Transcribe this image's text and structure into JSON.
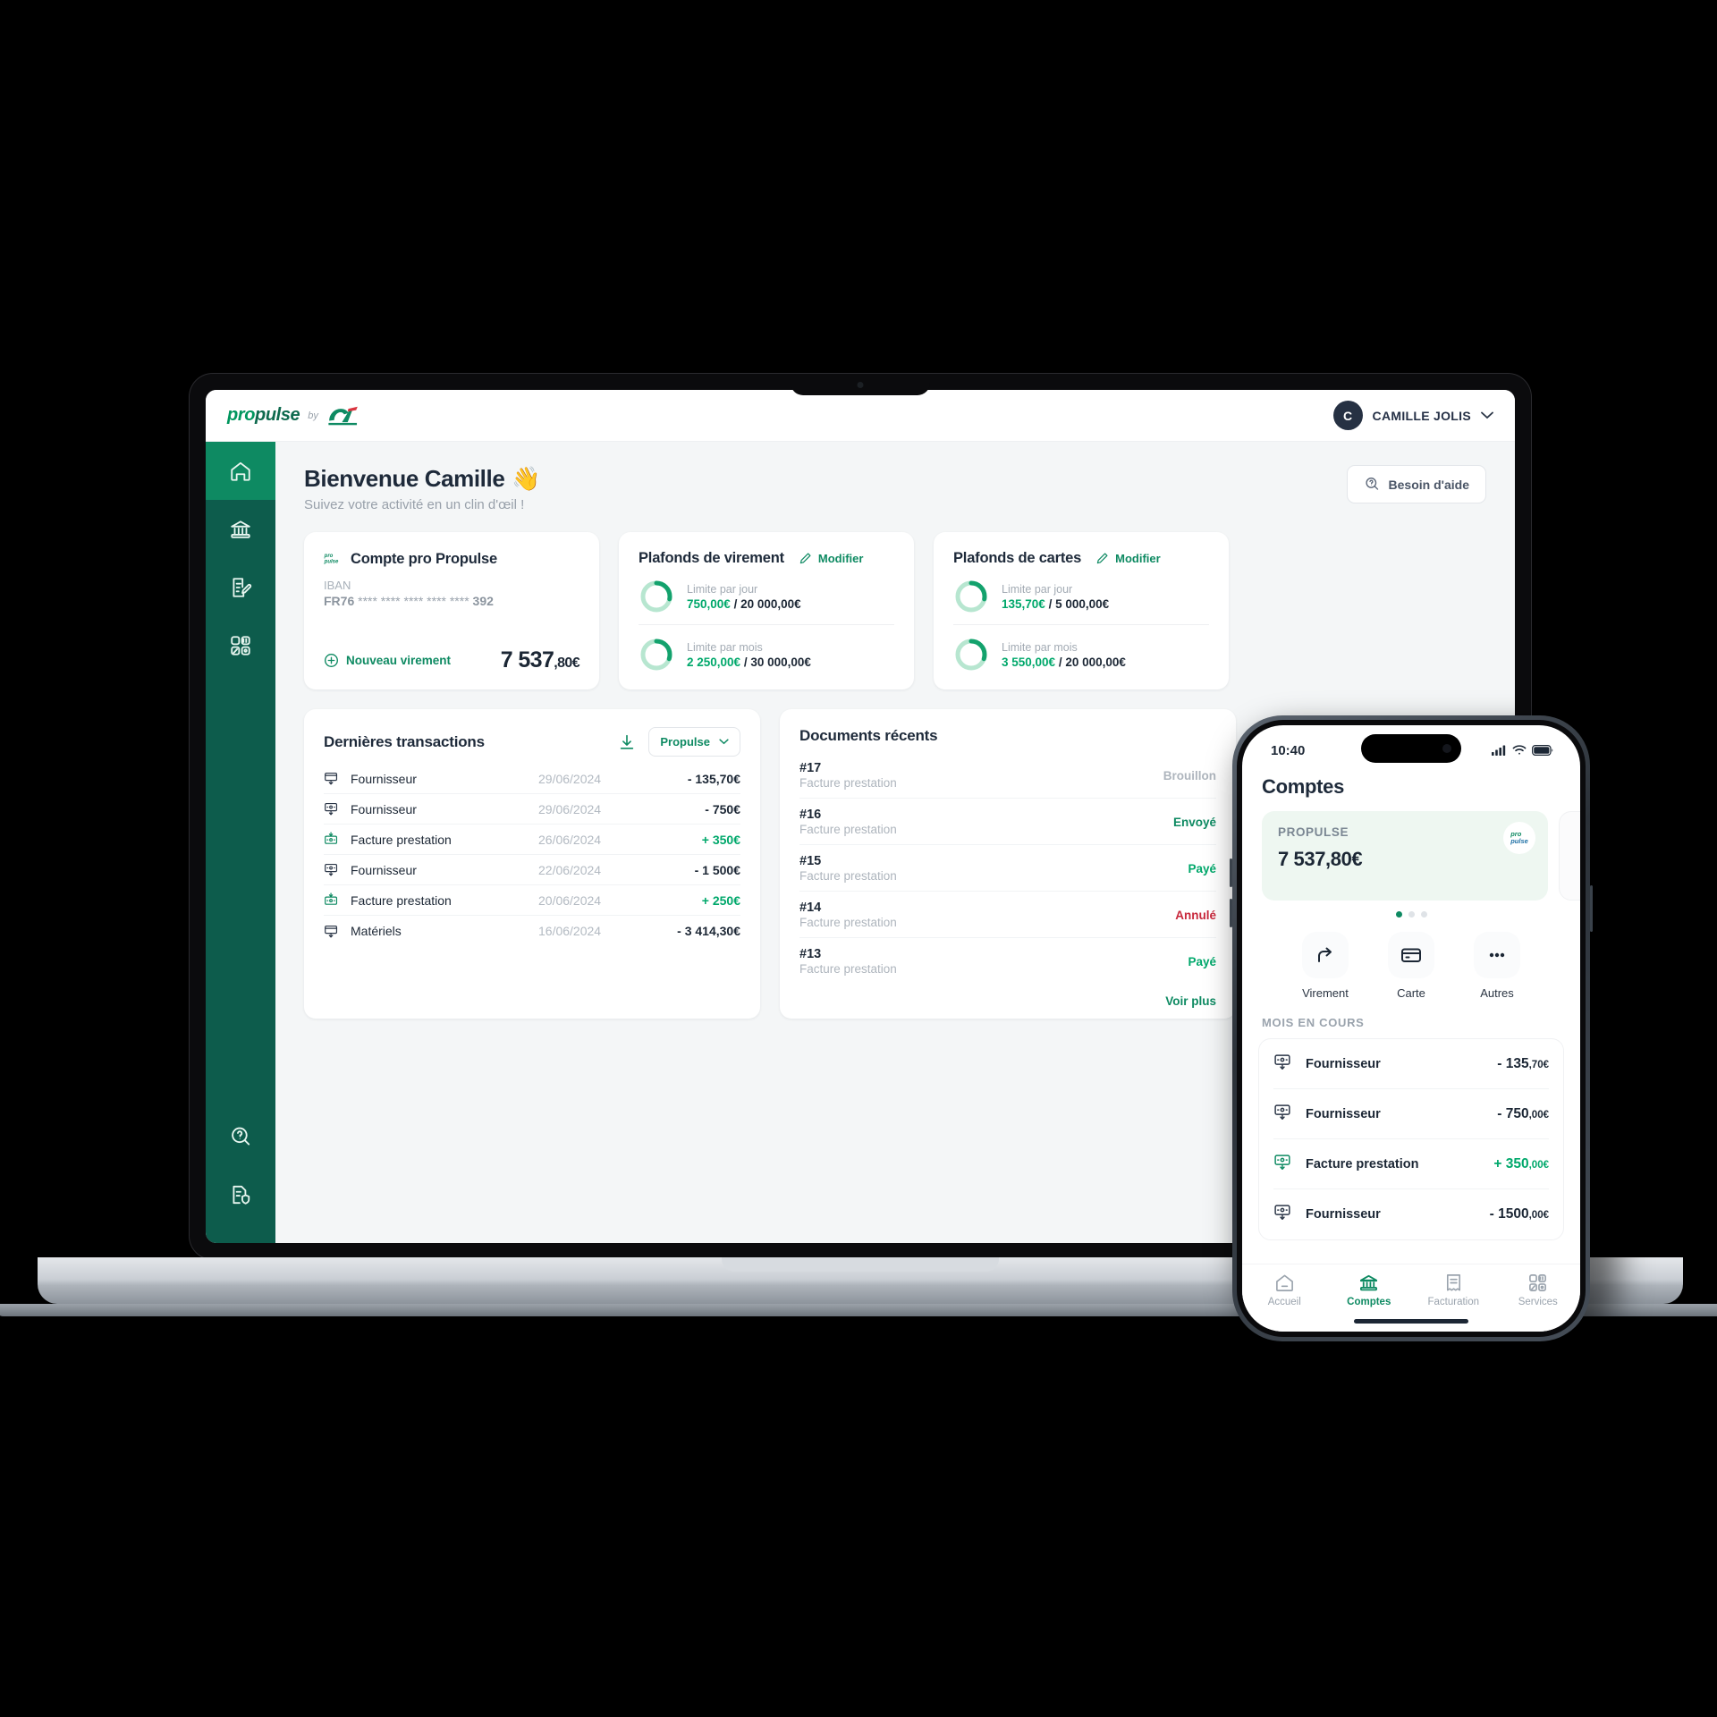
{
  "desktop": {
    "brand": {
      "name_pro": "pro",
      "name_pulse": "pulse",
      "by": "by",
      "ca": "CA"
    },
    "user": {
      "initial": "C",
      "name": "CAMILLE JOLIS"
    },
    "welcome": {
      "title": "Bienvenue Camille",
      "emoji": "👋",
      "subtitle": "Suivez votre activité en un clin d'œil !"
    },
    "help_button": "Besoin d'aide",
    "sidebar": [
      {
        "name": "home",
        "label": "Accueil",
        "active": true
      },
      {
        "name": "bank",
        "label": "Comptes",
        "active": false
      },
      {
        "name": "invoice-edit",
        "label": "Facturation",
        "active": false
      },
      {
        "name": "services-grid",
        "label": "Services",
        "active": false
      },
      {
        "name": "help-search",
        "label": "Aide",
        "active": false
      },
      {
        "name": "document-shield",
        "label": "Documents",
        "active": false
      }
    ],
    "account_card": {
      "title": "Compte pro Propulse",
      "iban_label": "IBAN",
      "iban_prefix": "FR76",
      "iban_mask": "**** **** **** **** ****",
      "iban_last": "392",
      "new_transfer": "Nouveau virement",
      "balance_main": "7 537",
      "balance_cents": ",80€"
    },
    "transfer_limits": {
      "title": "Plafonds de virement",
      "edit": "Modifier",
      "rows": [
        {
          "label": "Limite par jour",
          "used": "750,00€",
          "sep": " / ",
          "total": "20 000,00€",
          "pct": 28
        },
        {
          "label": "Limite par mois",
          "used": "2 250,00€",
          "sep": " / ",
          "total": "30 000,00€",
          "pct": 30
        }
      ]
    },
    "card_limits": {
      "title": "Plafonds de cartes",
      "edit": "Modifier",
      "rows": [
        {
          "label": "Limite par jour",
          "used": "135,70€",
          "sep": " / ",
          "total": "5 000,00€",
          "pct": 28
        },
        {
          "label": "Limite par mois",
          "used": "3 550,00€",
          "sep": " / ",
          "total": "20 000,00€",
          "pct": 30
        }
      ]
    },
    "transactions": {
      "title": "Dernières transactions",
      "filter": "Propulse",
      "rows": [
        {
          "icon": "card-down",
          "label": "Fournisseur",
          "date": "29/06/2024",
          "amount": "- 135,70€",
          "positive": false
        },
        {
          "icon": "transfer-down",
          "label": "Fournisseur",
          "date": "29/06/2024",
          "amount": "- 750€",
          "positive": false
        },
        {
          "icon": "transfer-in",
          "label": "Facture prestation",
          "date": "26/06/2024",
          "amount": "+ 350€",
          "positive": true
        },
        {
          "icon": "transfer-down",
          "label": "Fournisseur",
          "date": "22/06/2024",
          "amount": "- 1 500€",
          "positive": false
        },
        {
          "icon": "transfer-in",
          "label": "Facture prestation",
          "date": "20/06/2024",
          "amount": "+ 250€",
          "positive": true
        },
        {
          "icon": "card-down",
          "label": "Matériels",
          "date": "16/06/2024",
          "amount": "- 3 414,30€",
          "positive": false
        }
      ]
    },
    "documents": {
      "title": "Documents récents",
      "see_more": "Voir plus",
      "rows": [
        {
          "num": "#17",
          "type": "Facture prestation",
          "status": "Brouillon",
          "status_class": "st-draft"
        },
        {
          "num": "#16",
          "type": "Facture prestation",
          "status": "Envoyé",
          "status_class": "st-sent"
        },
        {
          "num": "#15",
          "type": "Facture prestation",
          "status": "Payé",
          "status_class": "st-paid"
        },
        {
          "num": "#14",
          "type": "Facture prestation",
          "status": "Annulé",
          "status_class": "st-cancel"
        },
        {
          "num": "#13",
          "type": "Facture prestation",
          "status": "Payé",
          "status_class": "st-paid"
        }
      ]
    }
  },
  "phone": {
    "status": {
      "time": "10:40"
    },
    "title": "Comptes",
    "account_card": {
      "label": "PROPULSE",
      "balance": "7 537,80€",
      "badge_pro": "pro",
      "badge_pulse": "pulse"
    },
    "quick_actions": [
      {
        "icon": "transfer-arrow",
        "label": "Virement"
      },
      {
        "icon": "credit-card",
        "label": "Carte"
      },
      {
        "icon": "ellipsis",
        "label": "Autres"
      }
    ],
    "section_label": "MOIS EN COURS",
    "transactions": [
      {
        "icon": "transfer-down",
        "label": "Fournisseur",
        "amount_main": "- 135",
        "amount_cents": ",70€",
        "positive": false
      },
      {
        "icon": "transfer-down",
        "label": "Fournisseur",
        "amount_main": "- 750",
        "amount_cents": ",00€",
        "positive": false
      },
      {
        "icon": "transfer-in",
        "label": "Facture prestation",
        "amount_main": "+ 350",
        "amount_cents": ",00€",
        "positive": true
      },
      {
        "icon": "transfer-down",
        "label": "Fournisseur",
        "amount_main": "- 1500",
        "amount_cents": ",00€",
        "positive": false
      }
    ],
    "tabs": [
      {
        "icon": "home",
        "label": "Accueil",
        "active": false
      },
      {
        "icon": "bank",
        "label": "Comptes",
        "active": true
      },
      {
        "icon": "receipt",
        "label": "Facturation",
        "active": false
      },
      {
        "icon": "grid",
        "label": "Services",
        "active": false
      }
    ]
  },
  "colors": {
    "brand_green": "#0e8a62",
    "sidebar_green": "#0d5c4c",
    "accent_green": "#00a86b",
    "danger": "#c8283c",
    "dark": "#1c2735"
  }
}
